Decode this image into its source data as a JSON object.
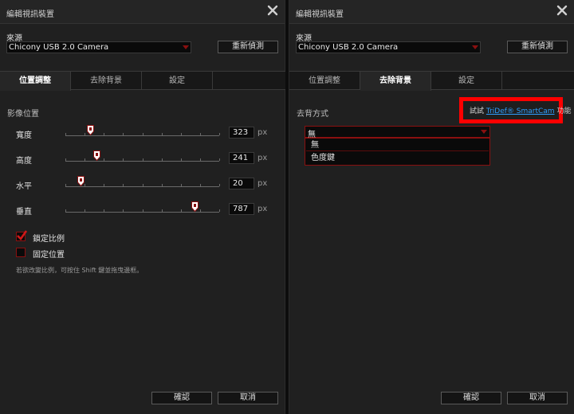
{
  "left": {
    "window_title": "編輯視訊裝置",
    "source_label": "來源",
    "source_value": "Chicony USB 2.0 Camera",
    "rescan_label": "重新偵測",
    "tabs": [
      "位置調整",
      "去除背景",
      "設定"
    ],
    "active_tab": 0,
    "section_label": "影像位置",
    "sliders": [
      {
        "label": "寬度",
        "value": "323",
        "unit": "px",
        "position": 0.16
      },
      {
        "label": "高度",
        "value": "241",
        "unit": "px",
        "position": 0.2
      },
      {
        "label": "水平",
        "value": "20",
        "unit": "px",
        "position": 0.1
      },
      {
        "label": "垂直",
        "value": "787",
        "unit": "px",
        "position": 0.84
      }
    ],
    "checkboxes": [
      {
        "label": "鎖定比例",
        "checked": true
      },
      {
        "label": "固定位置",
        "checked": false
      }
    ],
    "hint": "若欲改變比例，可按住 Shift 鍵並拖曳邊框。",
    "ok_label": "確認",
    "cancel_label": "取消"
  },
  "right": {
    "window_title": "編輯視訊裝置",
    "source_label": "來源",
    "source_value": "Chicony USB 2.0 Camera",
    "rescan_label": "重新偵測",
    "tabs": [
      "位置調整",
      "去除背景",
      "設定"
    ],
    "active_tab": 1,
    "removal_label": "去背方式",
    "try_prefix": "試試",
    "try_link": "TriDef® SmartCam",
    "try_suffix": "功能",
    "method_value": "無",
    "method_options": [
      "無",
      "色度鍵"
    ],
    "ok_label": "確認",
    "cancel_label": "取消"
  },
  "colors": {
    "accent_red": "#8a1010",
    "highlight_red": "#ff0000",
    "link_blue": "#2ea0ff",
    "panel_bg": "#202020"
  },
  "icons": {
    "close": "close-icon",
    "dropdown": "chevron-down-icon",
    "slider_thumb": "slider-thumb-icon",
    "check": "checkmark-icon"
  }
}
